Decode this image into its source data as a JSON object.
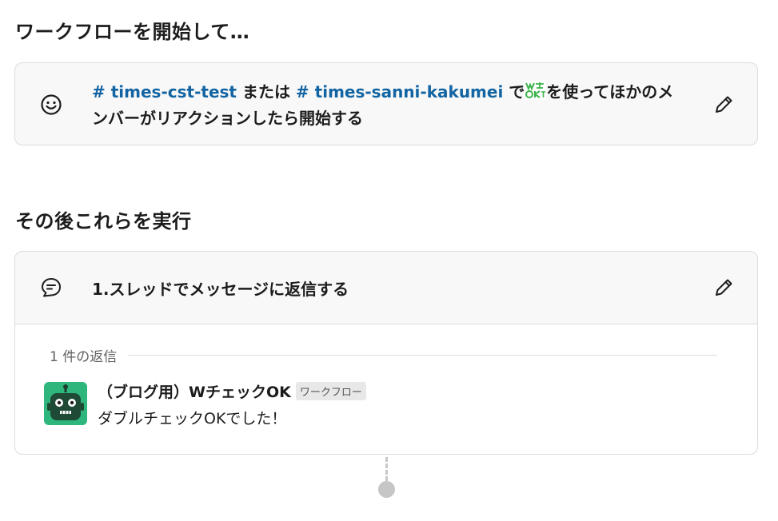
{
  "trigger_section": {
    "title": "ワークフローを開始して…",
    "text_part1": "times-cst-test",
    "text_or": " または ",
    "text_part2": "times-sanni-kakumei",
    "text_de": " で",
    "text_rest": "を使ってほかのメンバーがリアクションしたら開始する",
    "emoji_icon": "w-check-ok-emoji"
  },
  "steps_section": {
    "title": "その後これらを実行",
    "step1": {
      "title": "1.スレッドでメッセージに返信する",
      "reply_count": "1 件の返信",
      "message": {
        "name": "（ブログ用）WチェックOK",
        "badge": "ワークフロー",
        "text": "ダブルチェックOKでした！"
      }
    }
  },
  "colors": {
    "channel_link": "#1264a3",
    "avatar_bg": "#2eb67d",
    "card_bg": "#f8f8f8"
  }
}
